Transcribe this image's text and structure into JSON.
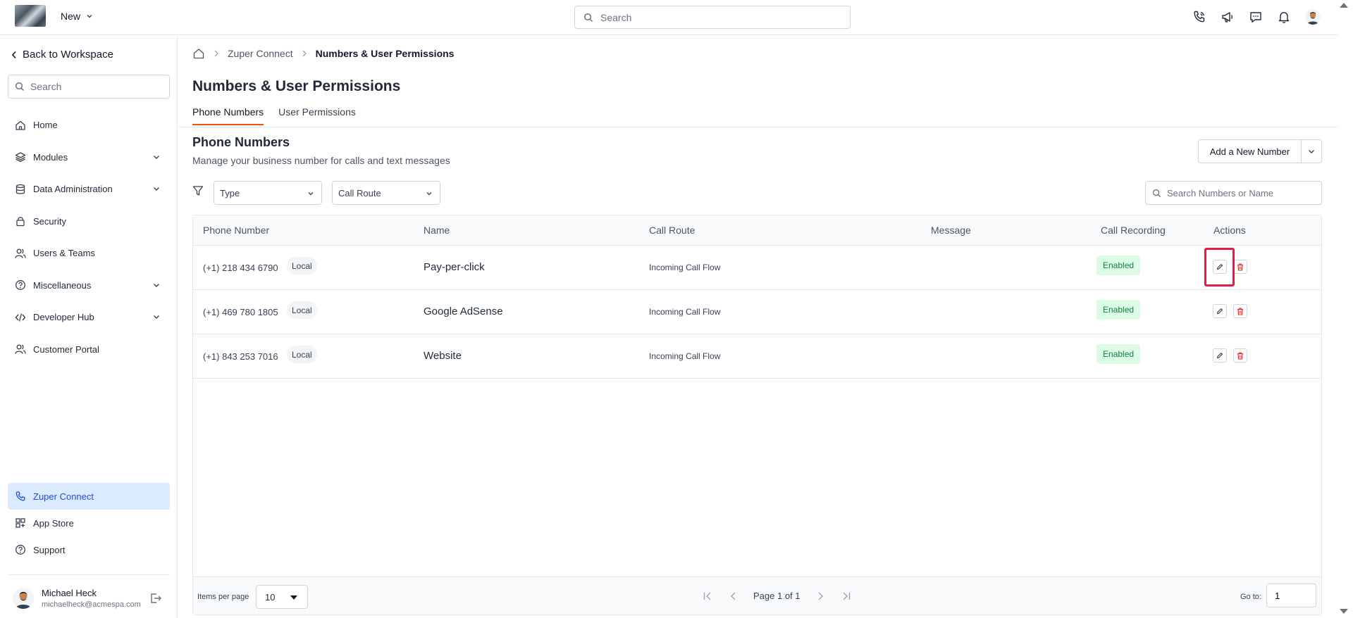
{
  "topbar": {
    "new_label": "New",
    "search_placeholder": "Search",
    "icons": [
      "phone-call-icon",
      "megaphone-icon",
      "chat-icon",
      "bell-icon",
      "avatar"
    ]
  },
  "sidebar": {
    "back_label": "Back to Workspace",
    "search_placeholder": "Search",
    "items": [
      {
        "label": "Home",
        "icon": "home-icon",
        "expandable": false
      },
      {
        "label": "Modules",
        "icon": "layers-icon",
        "expandable": true
      },
      {
        "label": "Data Administration",
        "icon": "database-icon",
        "expandable": true
      },
      {
        "label": "Security",
        "icon": "lock-icon",
        "expandable": false
      },
      {
        "label": "Users & Teams",
        "icon": "users-icon",
        "expandable": false
      },
      {
        "label": "Miscellaneous",
        "icon": "help-circle-icon",
        "expandable": true
      },
      {
        "label": "Developer Hub",
        "icon": "code-icon",
        "expandable": true
      },
      {
        "label": "Customer Portal",
        "icon": "users-icon",
        "expandable": false
      }
    ],
    "bottom_items": [
      {
        "label": "Zuper Connect",
        "icon": "phone-icon",
        "active": true
      },
      {
        "label": "App Store",
        "icon": "apps-icon",
        "active": false
      },
      {
        "label": "Support",
        "icon": "help-circle-icon",
        "active": false
      }
    ],
    "user": {
      "name": "Michael Heck",
      "email": "michaelheck@acmespa.com"
    }
  },
  "breadcrumb": {
    "parent": "Zuper Connect",
    "current": "Numbers & User Permissions"
  },
  "page": {
    "title": "Numbers & User Permissions",
    "tabs": [
      {
        "label": "Phone Numbers",
        "active": true
      },
      {
        "label": "User Permissions",
        "active": false
      }
    ],
    "section_title": "Phone Numbers",
    "section_subtitle": "Manage your business number for calls and text messages",
    "add_button": "Add a New Number",
    "filters": {
      "type": "Type",
      "call_route": "Call Route"
    },
    "number_search_placeholder": "Search Numbers or Name"
  },
  "table": {
    "columns": [
      "Phone Number",
      "Name",
      "Call Route",
      "Message",
      "Call Recording",
      "Actions"
    ],
    "rows": [
      {
        "phone": "(+1) 218 434 6790",
        "type": "Local",
        "name": "Pay-per-click",
        "route": "Incoming Call Flow",
        "message": "",
        "recording": "Enabled"
      },
      {
        "phone": "(+1) 469 780 1805",
        "type": "Local",
        "name": "Google AdSense",
        "route": "Incoming Call Flow",
        "message": "",
        "recording": "Enabled"
      },
      {
        "phone": "(+1) 843 253 7016",
        "type": "Local",
        "name": "Website",
        "route": "Incoming Call Flow",
        "message": "",
        "recording": "Enabled"
      }
    ]
  },
  "footer": {
    "items_per_page_label": "Items per page",
    "items_per_page": "10",
    "page_text": "Page 1 of 1",
    "goto_label": "Go to:",
    "goto_value": "1"
  },
  "colors": {
    "accent": "#ea580c",
    "active_nav_bg": "#dbeafe",
    "enabled_bg": "#dcfce7",
    "enabled_text": "#15803d",
    "delete": "#dc2626",
    "highlight": "#e11d48"
  }
}
